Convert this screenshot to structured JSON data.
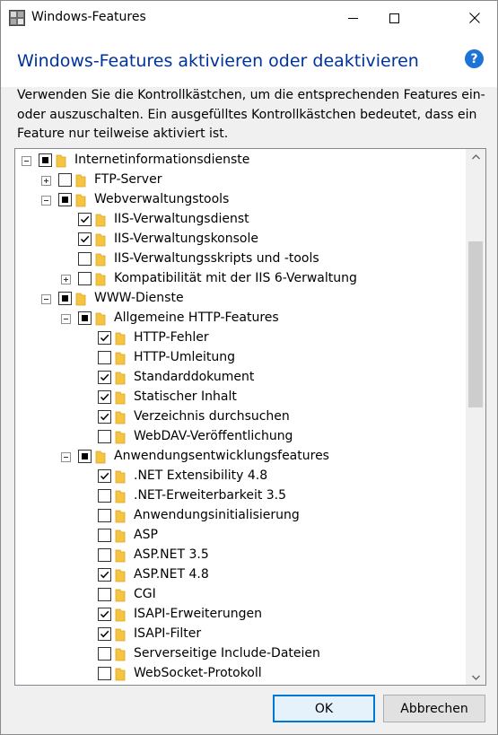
{
  "window": {
    "title": "Windows-Features"
  },
  "header": {
    "heading": "Windows-Features aktivieren oder deaktivieren"
  },
  "description": "Verwenden Sie die Kontrollkästchen, um die entsprechenden Features ein- oder auszuschalten. Ein ausgefülltes Kontrollkästchen bedeutet, dass ein Feature nur teilweise aktiviert ist.",
  "tree": {
    "items": [
      {
        "label": "Internetinformationsdienste",
        "level": 0,
        "expander": "minus",
        "state": "partial"
      },
      {
        "label": "FTP-Server",
        "level": 1,
        "expander": "plus",
        "state": "unchecked"
      },
      {
        "label": "Webverwaltungstools",
        "level": 1,
        "expander": "minus",
        "state": "partial"
      },
      {
        "label": "IIS-Verwaltungsdienst",
        "level": 2,
        "expander": "none",
        "state": "checked"
      },
      {
        "label": "IIS-Verwaltungskonsole",
        "level": 2,
        "expander": "none",
        "state": "checked"
      },
      {
        "label": "IIS-Verwaltungsskripts und -tools",
        "level": 2,
        "expander": "none",
        "state": "unchecked"
      },
      {
        "label": "Kompatibilität mit der IIS 6-Verwaltung",
        "level": 2,
        "expander": "plus",
        "state": "unchecked"
      },
      {
        "label": "WWW-Dienste",
        "level": 1,
        "expander": "minus",
        "state": "partial"
      },
      {
        "label": "Allgemeine HTTP-Features",
        "level": 2,
        "expander": "minus",
        "state": "partial"
      },
      {
        "label": "HTTP-Fehler",
        "level": 3,
        "expander": "none",
        "state": "checked"
      },
      {
        "label": "HTTP-Umleitung",
        "level": 3,
        "expander": "none",
        "state": "unchecked"
      },
      {
        "label": "Standarddokument",
        "level": 3,
        "expander": "none",
        "state": "checked"
      },
      {
        "label": "Statischer Inhalt",
        "level": 3,
        "expander": "none",
        "state": "checked"
      },
      {
        "label": "Verzeichnis durchsuchen",
        "level": 3,
        "expander": "none",
        "state": "checked"
      },
      {
        "label": "WebDAV-Veröffentlichung",
        "level": 3,
        "expander": "none",
        "state": "unchecked"
      },
      {
        "label": "Anwendungsentwicklungsfeatures",
        "level": 2,
        "expander": "minus",
        "state": "partial"
      },
      {
        "label": ".NET Extensibility 4.8",
        "level": 3,
        "expander": "none",
        "state": "checked"
      },
      {
        "label": ".NET-Erweiterbarkeit 3.5",
        "level": 3,
        "expander": "none",
        "state": "unchecked"
      },
      {
        "label": "Anwendungsinitialisierung",
        "level": 3,
        "expander": "none",
        "state": "unchecked"
      },
      {
        "label": "ASP",
        "level": 3,
        "expander": "none",
        "state": "unchecked"
      },
      {
        "label": "ASP.NET 3.5",
        "level": 3,
        "expander": "none",
        "state": "unchecked"
      },
      {
        "label": "ASP.NET 4.8",
        "level": 3,
        "expander": "none",
        "state": "checked"
      },
      {
        "label": "CGI",
        "level": 3,
        "expander": "none",
        "state": "unchecked"
      },
      {
        "label": "ISAPI-Erweiterungen",
        "level": 3,
        "expander": "none",
        "state": "checked"
      },
      {
        "label": "ISAPI-Filter",
        "level": 3,
        "expander": "none",
        "state": "checked"
      },
      {
        "label": "Serverseitige Include-Dateien",
        "level": 3,
        "expander": "none",
        "state": "unchecked"
      },
      {
        "label": "WebSocket-Protokoll",
        "level": 3,
        "expander": "none",
        "state": "unchecked"
      }
    ]
  },
  "buttons": {
    "ok": "OK",
    "cancel": "Abbrechen"
  },
  "colors": {
    "heading": "#003399",
    "accent": "#0078d7",
    "folder": "#f5c542"
  }
}
